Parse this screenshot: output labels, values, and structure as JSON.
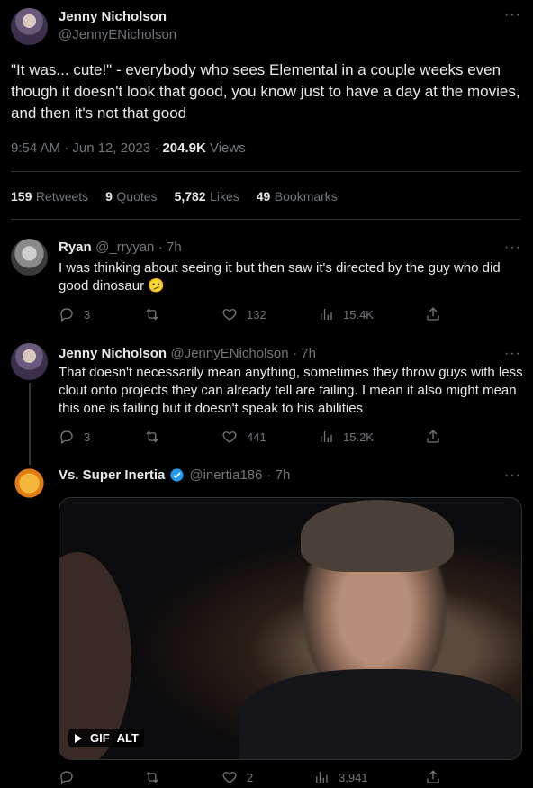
{
  "main_tweet": {
    "author_name": "Jenny Nicholson",
    "author_handle": "@JennyENicholson",
    "text": "\"It was... cute!\" - everybody who sees Elemental in a couple weeks even though it doesn't look that good, you know just to have a day at the movies, and then it's not that good",
    "timestamp": "9:54 AM · Jun 12, 2023 · ",
    "views_count": "204.9K",
    "views_label": " Views",
    "stats": {
      "retweets_count": "159",
      "retweets_label": "Retweets",
      "quotes_count": "9",
      "quotes_label": "Quotes",
      "likes_count": "5,782",
      "likes_label": "Likes",
      "bookmarks_count": "49",
      "bookmarks_label": "Bookmarks"
    }
  },
  "replies": [
    {
      "author_name": "Ryan",
      "author_handle": "@_rryyan",
      "time": "· 7h",
      "text": "I was thinking about seeing it but then saw it's directed by the guy who did good dinosaur",
      "emoji": "🫤",
      "reply_count": "3",
      "retweet_count": "",
      "like_count": "132",
      "view_count": "15.4K"
    },
    {
      "author_name": "Jenny Nicholson",
      "author_handle": "@JennyENicholson",
      "time": "· 7h",
      "text": "That doesn't necessarily mean anything, sometimes they throw guys with less clout onto projects they can already tell are failing. I mean it also might mean this one is failing but it doesn't speak to his abilities",
      "reply_count": "3",
      "retweet_count": "",
      "like_count": "441",
      "view_count": "15.2K"
    },
    {
      "author_name": "Vs. Super Inertia",
      "author_handle": "@inertia186",
      "time": "· 7h",
      "verified": true,
      "media_badges": [
        "GIF",
        "ALT"
      ],
      "reply_count": "",
      "retweet_count": "",
      "like_count": "2",
      "view_count": "3,941"
    }
  ],
  "icons": {
    "more": "more-icon",
    "reply": "reply-icon",
    "retweet": "retweet-icon",
    "like": "heart-icon",
    "views": "analytics-icon",
    "share": "share-icon",
    "verified": "verified-badge-icon",
    "play": "play-icon"
  },
  "colors": {
    "background": "#000000",
    "text": "#e7e9ea",
    "muted": "#71767b",
    "divider": "#2f3336",
    "verified": "#1d9bf0"
  }
}
